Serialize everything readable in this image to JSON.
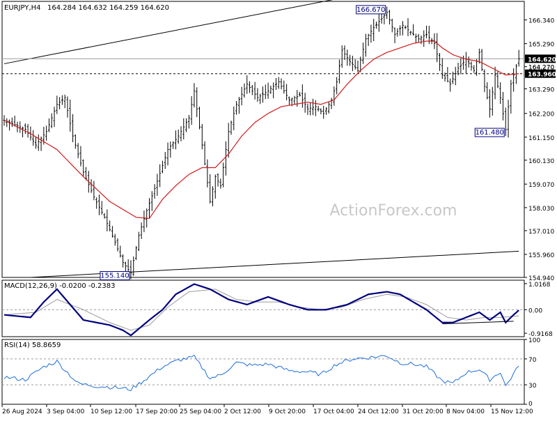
{
  "header": {
    "symbol": "EURJPY,H4",
    "ohlc": "164.284 164.632 164.259 164.620"
  },
  "watermark": "ActionForex.com",
  "colors": {
    "candle": "#000000",
    "ma": "#d11a1a",
    "macd_line": "#000080",
    "macd_signal": "#9a9a9a",
    "rsi_line": "#1e6fd9",
    "trendline": "#000000",
    "price_line": "#9a9a9a",
    "label_bg": "#000000",
    "label_text": "#ffffff",
    "annotation_border": "#000080",
    "watermark": "#c8c8c8"
  },
  "chart_data": [
    {
      "type": "candlestick",
      "name": "price",
      "ylim": [
        154.94,
        167.16
      ],
      "y_ticks": [
        "166.340",
        "165.290",
        "164.270",
        "163.290",
        "162.200",
        "161.150",
        "160.130",
        "159.070",
        "158.030",
        "157.010",
        "155.960",
        "154.940"
      ],
      "x_ticks": [
        "26 Aug 2024",
        "3 Sep 04:00",
        "10 Sep 12:00",
        "17 Sep 20:00",
        "25 Sep 04:00",
        "2 Oct 12:00",
        "9 Oct 20:00",
        "17 Oct 04:00",
        "24 Oct 12:00",
        "31 Oct 20:00",
        "8 Nov 04:00",
        "15 Nov 12:00"
      ],
      "key_points": [
        [
          0,
          161.9
        ],
        [
          8,
          161.5
        ],
        [
          12,
          160.8
        ],
        [
          16,
          161.4
        ],
        [
          20,
          162.6
        ],
        [
          23,
          162.9
        ],
        [
          26,
          161.2
        ],
        [
          30,
          159.6
        ],
        [
          34,
          158.5
        ],
        [
          38,
          157.6
        ],
        [
          42,
          156.5
        ],
        [
          45,
          155.6
        ],
        [
          48,
          155.14
        ],
        [
          51,
          156.8
        ],
        [
          54,
          157.9
        ],
        [
          58,
          159.2
        ],
        [
          62,
          160.6
        ],
        [
          66,
          161.2
        ],
        [
          70,
          162.0
        ],
        [
          72,
          163.2
        ],
        [
          75,
          160.8
        ],
        [
          78,
          158.3
        ],
        [
          80,
          159.4
        ],
        [
          82,
          159.0
        ],
        [
          85,
          161.4
        ],
        [
          88,
          162.6
        ],
        [
          92,
          163.5
        ],
        [
          96,
          162.9
        ],
        [
          100,
          163.2
        ],
        [
          104,
          163.6
        ],
        [
          108,
          162.8
        ],
        [
          112,
          163.0
        ],
        [
          115,
          162.4
        ],
        [
          118,
          162.5
        ],
        [
          121,
          162.2
        ],
        [
          124,
          162.8
        ],
        [
          126,
          163.6
        ],
        [
          128,
          165.0
        ],
        [
          131,
          164.5
        ],
        [
          134,
          164.1
        ],
        [
          137,
          165.5
        ],
        [
          140,
          166.0
        ],
        [
          143,
          166.4
        ],
        [
          145,
          166.67
        ],
        [
          148,
          165.7
        ],
        [
          151,
          166.1
        ],
        [
          154,
          165.8
        ],
        [
          157,
          165.5
        ],
        [
          160,
          165.7
        ],
        [
          163,
          165.3
        ],
        [
          166,
          163.9
        ],
        [
          169,
          163.5
        ],
        [
          172,
          164.2
        ],
        [
          175,
          164.6
        ],
        [
          178,
          164.1
        ],
        [
          180,
          164.9
        ],
        [
          182,
          163.4
        ],
        [
          184,
          162.4
        ],
        [
          186,
          163.9
        ],
        [
          188,
          162.9
        ],
        [
          190,
          161.48
        ],
        [
          192,
          163.5
        ],
        [
          194,
          164.3
        ],
        [
          195,
          164.62
        ]
      ],
      "moving_average_points": [
        [
          0,
          161.9
        ],
        [
          10,
          161.3
        ],
        [
          20,
          160.6
        ],
        [
          30,
          159.4
        ],
        [
          40,
          158.3
        ],
        [
          50,
          157.6
        ],
        [
          55,
          157.55
        ],
        [
          60,
          158.4
        ],
        [
          65,
          159.0
        ],
        [
          70,
          159.5
        ],
        [
          75,
          159.8
        ],
        [
          80,
          159.8
        ],
        [
          85,
          160.4
        ],
        [
          90,
          161.2
        ],
        [
          95,
          161.8
        ],
        [
          100,
          162.2
        ],
        [
          105,
          162.5
        ],
        [
          110,
          162.6
        ],
        [
          115,
          162.7
        ],
        [
          120,
          162.6
        ],
        [
          125,
          162.8
        ],
        [
          130,
          163.5
        ],
        [
          135,
          164.1
        ],
        [
          140,
          164.6
        ],
        [
          145,
          164.9
        ],
        [
          150,
          165.1
        ],
        [
          155,
          165.3
        ],
        [
          160,
          165.4
        ],
        [
          163,
          165.4
        ],
        [
          166,
          165.1
        ],
        [
          170,
          164.8
        ],
        [
          175,
          164.6
        ],
        [
          180,
          164.5
        ],
        [
          185,
          164.2
        ],
        [
          190,
          163.9
        ],
        [
          195,
          163.96
        ]
      ],
      "annotations": [
        {
          "label": "166.670",
          "index": 145,
          "value": 166.67,
          "position": "above"
        },
        {
          "label": "155.140",
          "index": 48,
          "value": 155.14,
          "position": "below"
        },
        {
          "label": "161.480",
          "index": 190,
          "value": 161.48,
          "position": "below"
        }
      ],
      "current_labels": [
        {
          "label": "164.620",
          "value": 164.62
        },
        {
          "label": "163.960",
          "value": 163.96
        }
      ],
      "partial_tick_label": "164.270",
      "trendlines": [
        {
          "from": [
            0,
            164.4
          ],
          "to": [
            180,
            168.5
          ]
        },
        {
          "from": [
            10,
            154.94
          ],
          "to": [
            195,
            156.1
          ]
        }
      ],
      "horizontal_lines": [
        {
          "value": 164.62,
          "style": "solid"
        },
        {
          "value": 163.96,
          "style": "dashed"
        }
      ]
    },
    {
      "type": "line",
      "name": "macd",
      "title": "MACD(12,26,9) -0.0200 -0.2383",
      "ylim": [
        -1.05,
        1.15
      ],
      "y_ticks": [
        "1.0168",
        "0.00",
        "-0.9168"
      ],
      "zero_label": "0.00",
      "key_points": [
        [
          0,
          -0.2
        ],
        [
          10,
          -0.3
        ],
        [
          15,
          0.3
        ],
        [
          20,
          0.8
        ],
        [
          30,
          -0.4
        ],
        [
          40,
          -0.6
        ],
        [
          45,
          -0.8
        ],
        [
          48,
          -1.0
        ],
        [
          55,
          -0.4
        ],
        [
          60,
          0.0
        ],
        [
          65,
          0.6
        ],
        [
          72,
          1.0
        ],
        [
          78,
          0.8
        ],
        [
          85,
          0.4
        ],
        [
          92,
          0.2
        ],
        [
          100,
          0.5
        ],
        [
          108,
          0.2
        ],
        [
          115,
          0.0
        ],
        [
          122,
          0.0
        ],
        [
          130,
          0.2
        ],
        [
          138,
          0.6
        ],
        [
          145,
          0.7
        ],
        [
          150,
          0.6
        ],
        [
          155,
          0.3
        ],
        [
          160,
          0.0
        ],
        [
          166,
          -0.5
        ],
        [
          170,
          -0.5
        ],
        [
          175,
          -0.3
        ],
        [
          180,
          -0.1
        ],
        [
          184,
          -0.4
        ],
        [
          188,
          -0.1
        ],
        [
          190,
          -0.5
        ],
        [
          193,
          -0.2
        ],
        [
          195,
          -0.02
        ]
      ],
      "signal_points": [
        [
          0,
          -0.2
        ],
        [
          12,
          -0.1
        ],
        [
          20,
          0.4
        ],
        [
          30,
          0.0
        ],
        [
          40,
          -0.5
        ],
        [
          48,
          -0.8
        ],
        [
          55,
          -0.6
        ],
        [
          62,
          0.1
        ],
        [
          70,
          0.7
        ],
        [
          80,
          0.8
        ],
        [
          88,
          0.4
        ],
        [
          96,
          0.3
        ],
        [
          104,
          0.3
        ],
        [
          112,
          0.1
        ],
        [
          120,
          0.0
        ],
        [
          128,
          0.1
        ],
        [
          136,
          0.4
        ],
        [
          145,
          0.6
        ],
        [
          152,
          0.5
        ],
        [
          160,
          0.2
        ],
        [
          168,
          -0.3
        ],
        [
          175,
          -0.4
        ],
        [
          182,
          -0.3
        ],
        [
          188,
          -0.3
        ],
        [
          195,
          -0.24
        ]
      ],
      "support_line": {
        "from": [
          166,
          -0.55
        ],
        "to": [
          193,
          -0.45
        ]
      }
    },
    {
      "type": "line",
      "name": "rsi",
      "title": "RSI(14) 58.8659",
      "ylim": [
        0,
        100
      ],
      "y_ticks": [
        "100",
        "70",
        "30",
        "0"
      ],
      "levels": [
        70,
        30
      ],
      "key_points": [
        [
          0,
          42
        ],
        [
          8,
          38
        ],
        [
          15,
          58
        ],
        [
          20,
          66
        ],
        [
          28,
          32
        ],
        [
          35,
          28
        ],
        [
          42,
          26
        ],
        [
          48,
          23
        ],
        [
          54,
          40
        ],
        [
          60,
          58
        ],
        [
          66,
          68
        ],
        [
          72,
          73
        ],
        [
          78,
          40
        ],
        [
          82,
          45
        ],
        [
          88,
          64
        ],
        [
          94,
          60
        ],
        [
          100,
          62
        ],
        [
          108,
          52
        ],
        [
          115,
          50
        ],
        [
          120,
          46
        ],
        [
          126,
          62
        ],
        [
          132,
          70
        ],
        [
          138,
          72
        ],
        [
          145,
          75
        ],
        [
          150,
          64
        ],
        [
          155,
          62
        ],
        [
          160,
          58
        ],
        [
          166,
          36
        ],
        [
          170,
          32
        ],
        [
          175,
          49
        ],
        [
          180,
          54
        ],
        [
          184,
          38
        ],
        [
          188,
          50
        ],
        [
          190,
          28
        ],
        [
          193,
          47
        ],
        [
          195,
          58.87
        ]
      ]
    }
  ]
}
